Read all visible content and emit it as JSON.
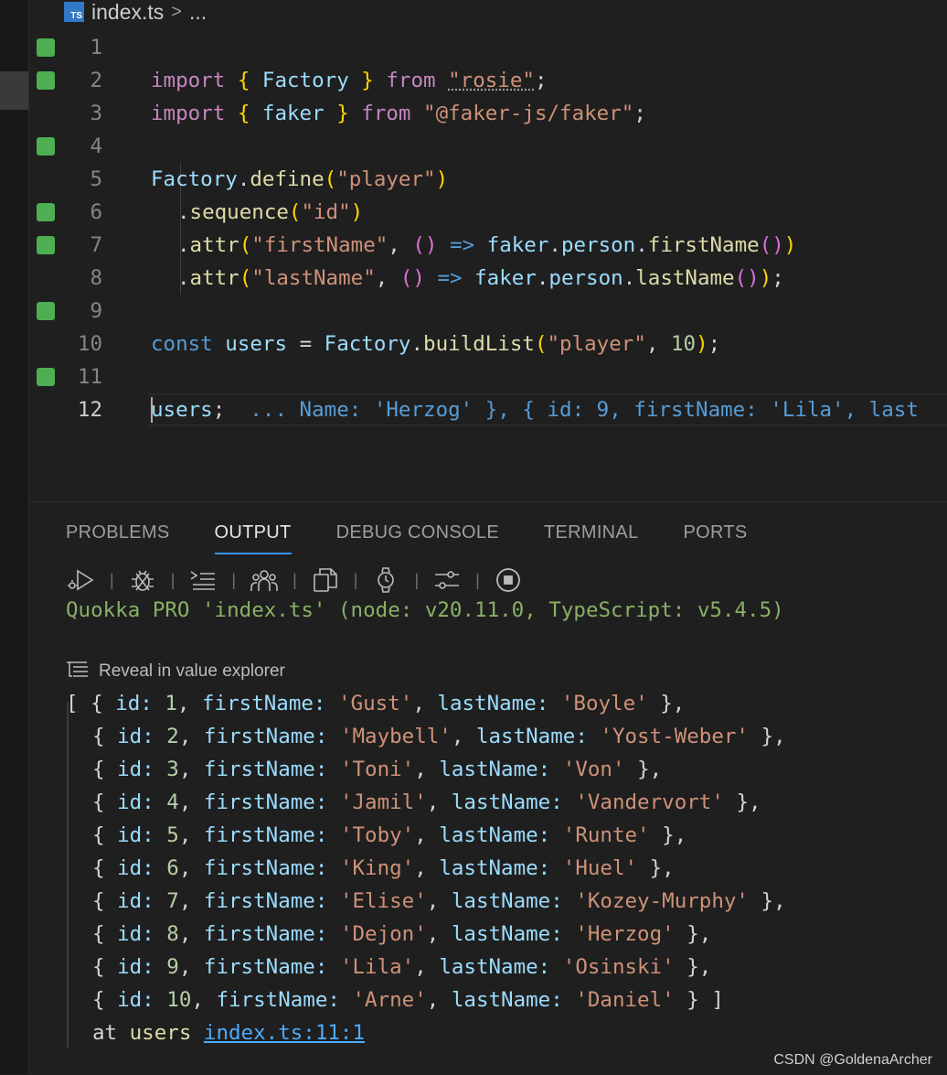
{
  "breadcrumb": {
    "file_icon_text": "TS",
    "file": "index.ts",
    "separator": ">",
    "more": "..."
  },
  "editor": {
    "lines": [
      {
        "num": "1",
        "changed": true
      },
      {
        "num": "2",
        "changed": true
      },
      {
        "num": "3",
        "changed": false
      },
      {
        "num": "4",
        "changed": true
      },
      {
        "num": "5",
        "changed": false
      },
      {
        "num": "6",
        "changed": true
      },
      {
        "num": "7",
        "changed": true
      },
      {
        "num": "8",
        "changed": false
      },
      {
        "num": "9",
        "changed": true
      },
      {
        "num": "10",
        "changed": false
      },
      {
        "num": "11",
        "changed": true
      },
      {
        "num": "12",
        "changed": false
      }
    ],
    "code": {
      "l1": {
        "kw": "import",
        "ob": "{",
        "id": "Factory",
        "cb": "}",
        "from": "from",
        "src": "\"rosie\"",
        "semi": ";"
      },
      "l2": {
        "kw": "import",
        "ob": "{",
        "id": "faker",
        "cb": "}",
        "from": "from",
        "src": "\"@faker-js/faker\"",
        "semi": ";"
      },
      "l4": {
        "obj": "Factory",
        "dot": ".",
        "fn": "define",
        "op": "(",
        "arg": "\"player\"",
        "cp": ")"
      },
      "l5": {
        "dot": ".",
        "fn": "sequence",
        "op": "(",
        "arg": "\"id\"",
        "cp": ")"
      },
      "l6": {
        "dot": ".",
        "fn": "attr",
        "op": "(",
        "arg": "\"firstName\"",
        "comma": ", ",
        "params": "()",
        "arrow": "=>",
        "obj": "faker",
        "d1": ".",
        "prop": "person",
        "d2": ".",
        "call": "firstName",
        "callp": "()",
        "cp": ")"
      },
      "l7": {
        "dot": ".",
        "fn": "attr",
        "op": "(",
        "arg": "\"lastName\"",
        "comma": ", ",
        "params": "()",
        "arrow": "=>",
        "obj": "faker",
        "d1": ".",
        "prop": "person",
        "d2": ".",
        "call": "lastName",
        "callp": "()",
        "cp": ")",
        "semi": ";"
      },
      "l9": {
        "kw": "const",
        "var": "users",
        "eq": "=",
        "obj": "Factory",
        "dot": ".",
        "fn": "buildList",
        "op": "(",
        "arg": "\"player\"",
        "comma": ", ",
        "num": "10",
        "cp": ")",
        "semi": ";"
      },
      "l11": {
        "var": "users",
        "semi": ";",
        "result": "... Name: 'Herzog' }, { id: 9, firstName: 'Lila', last"
      }
    }
  },
  "panel": {
    "tabs": [
      "PROBLEMS",
      "OUTPUT",
      "DEBUG CONSOLE",
      "TERMINAL",
      "PORTS"
    ],
    "active_tab": "OUTPUT",
    "toolbar_icons": [
      "run-icon",
      "debug-icon",
      "list-indent-icon",
      "people-icon",
      "copy-icon",
      "watch-icon",
      "settings-sliders-icon",
      "stop-icon"
    ],
    "quokka_line": "Quokka PRO 'index.ts' (node: v20.11.0, TypeScript: v5.4.5)",
    "reveal_label": "Reveal in value explorer",
    "output_open": "[",
    "output_close": " ]",
    "records": [
      {
        "id": "1",
        "firstName": "'Gust'",
        "lastName": "'Boyle'"
      },
      {
        "id": "2",
        "firstName": "'Maybell'",
        "lastName": "'Yost-Weber'"
      },
      {
        "id": "3",
        "firstName": "'Toni'",
        "lastName": "'Von'"
      },
      {
        "id": "4",
        "firstName": "'Jamil'",
        "lastName": "'Vandervort'"
      },
      {
        "id": "5",
        "firstName": "'Toby'",
        "lastName": "'Runte'"
      },
      {
        "id": "6",
        "firstName": "'King'",
        "lastName": "'Huel'"
      },
      {
        "id": "7",
        "firstName": "'Elise'",
        "lastName": "'Kozey-Murphy'"
      },
      {
        "id": "8",
        "firstName": "'Dejon'",
        "lastName": "'Herzog'"
      },
      {
        "id": "9",
        "firstName": "'Lila'",
        "lastName": "'Osinski'"
      },
      {
        "id": "10",
        "firstName": "'Arne'",
        "lastName": "'Daniel'"
      }
    ],
    "keys": {
      "id": "id:",
      "firstName": "firstName:",
      "lastName": "lastName:"
    },
    "at_label": "at",
    "at_var": "users",
    "at_link": "index.ts:11:1"
  },
  "watermark": "CSDN @GoldenaArcher",
  "colors": {
    "accent": "#3794ff",
    "gutter_added": "#4caf50",
    "quokka_text": "#89b067",
    "link": "#4daafc"
  }
}
